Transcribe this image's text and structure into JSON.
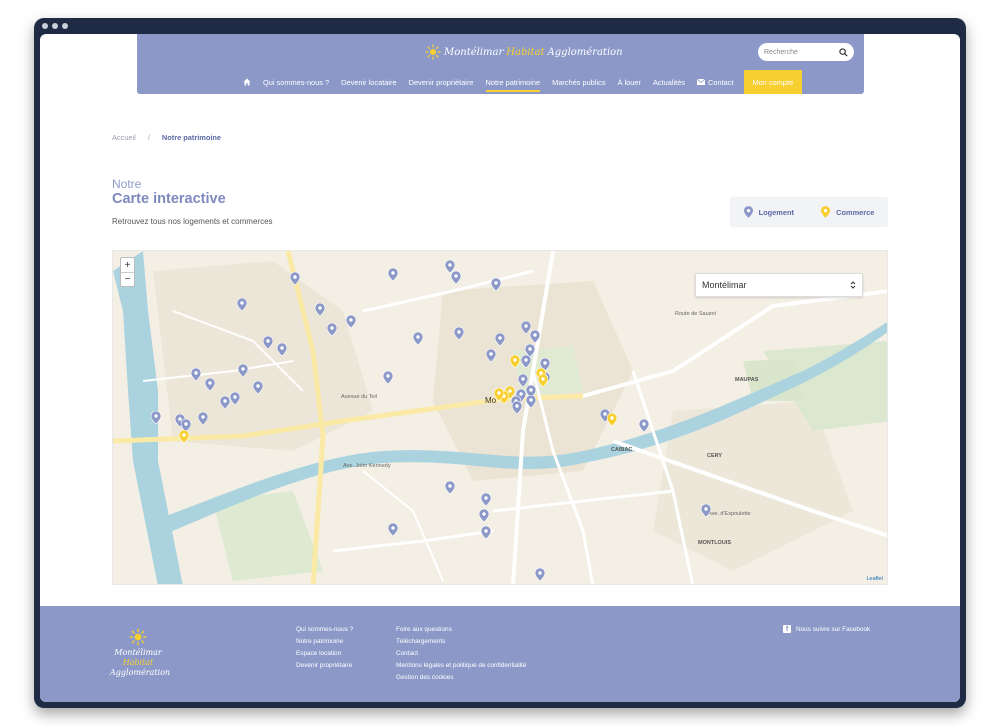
{
  "header": {
    "logo": {
      "part1": "Montélimar",
      "part2": "Agglomération",
      "tagline": "Habitat"
    },
    "search_placeholder": "Recherche",
    "nav": [
      {
        "label": "Qui sommes-nous ?"
      },
      {
        "label": "Devenir locataire"
      },
      {
        "label": "Devenir propriétaire"
      },
      {
        "label": "Notre patrimoine"
      },
      {
        "label": "Marchés publics"
      },
      {
        "label": "À louer"
      },
      {
        "label": "Actualités"
      },
      {
        "label": "Contact"
      }
    ],
    "account_button": "Mon compte"
  },
  "breadcrumb": {
    "home": "Accueil",
    "separator": "/",
    "current": "Notre patrimoine"
  },
  "page": {
    "overline": "Notre",
    "title": "Carte interactive",
    "subtitle": "Retrouvez tous nos logements et commerces"
  },
  "legend": {
    "logement": "Logement",
    "commerce": "Commerce"
  },
  "map": {
    "zoom_in": "+",
    "zoom_out": "−",
    "city_selected": "Montélimar",
    "labels": {
      "maupas": "MAUPAS",
      "cabiac": "CABIAC",
      "cery": "CERY",
      "montlouis": "MONTLOUIS",
      "center": "Mo",
      "avenue_teil": "Avenue du Teil",
      "ave_kennedy": "Ave. John Kennedy",
      "ave_espoulette": "Ave. d'Espoulette",
      "route_sauzet": "Route de Sauzet"
    },
    "attribution": "Leaflet",
    "colors": {
      "logement": "#8c99c8",
      "commerce": "#f7cf30"
    }
  },
  "footer": {
    "logo": {
      "line1": "Montélimar",
      "line2": "Habitat",
      "line3": "Agglomération"
    },
    "col1": [
      "Qui sommes-nous ?",
      "Notre patrimoine",
      "Espace location",
      "Devenir propriétaire"
    ],
    "col2": [
      "Foire aux questions",
      "Téléchargements",
      "Contact",
      "Mentions légales et politique de confidentialité",
      "Gestion des cookies"
    ],
    "facebook": "Nous suivre sur Facebook"
  }
}
